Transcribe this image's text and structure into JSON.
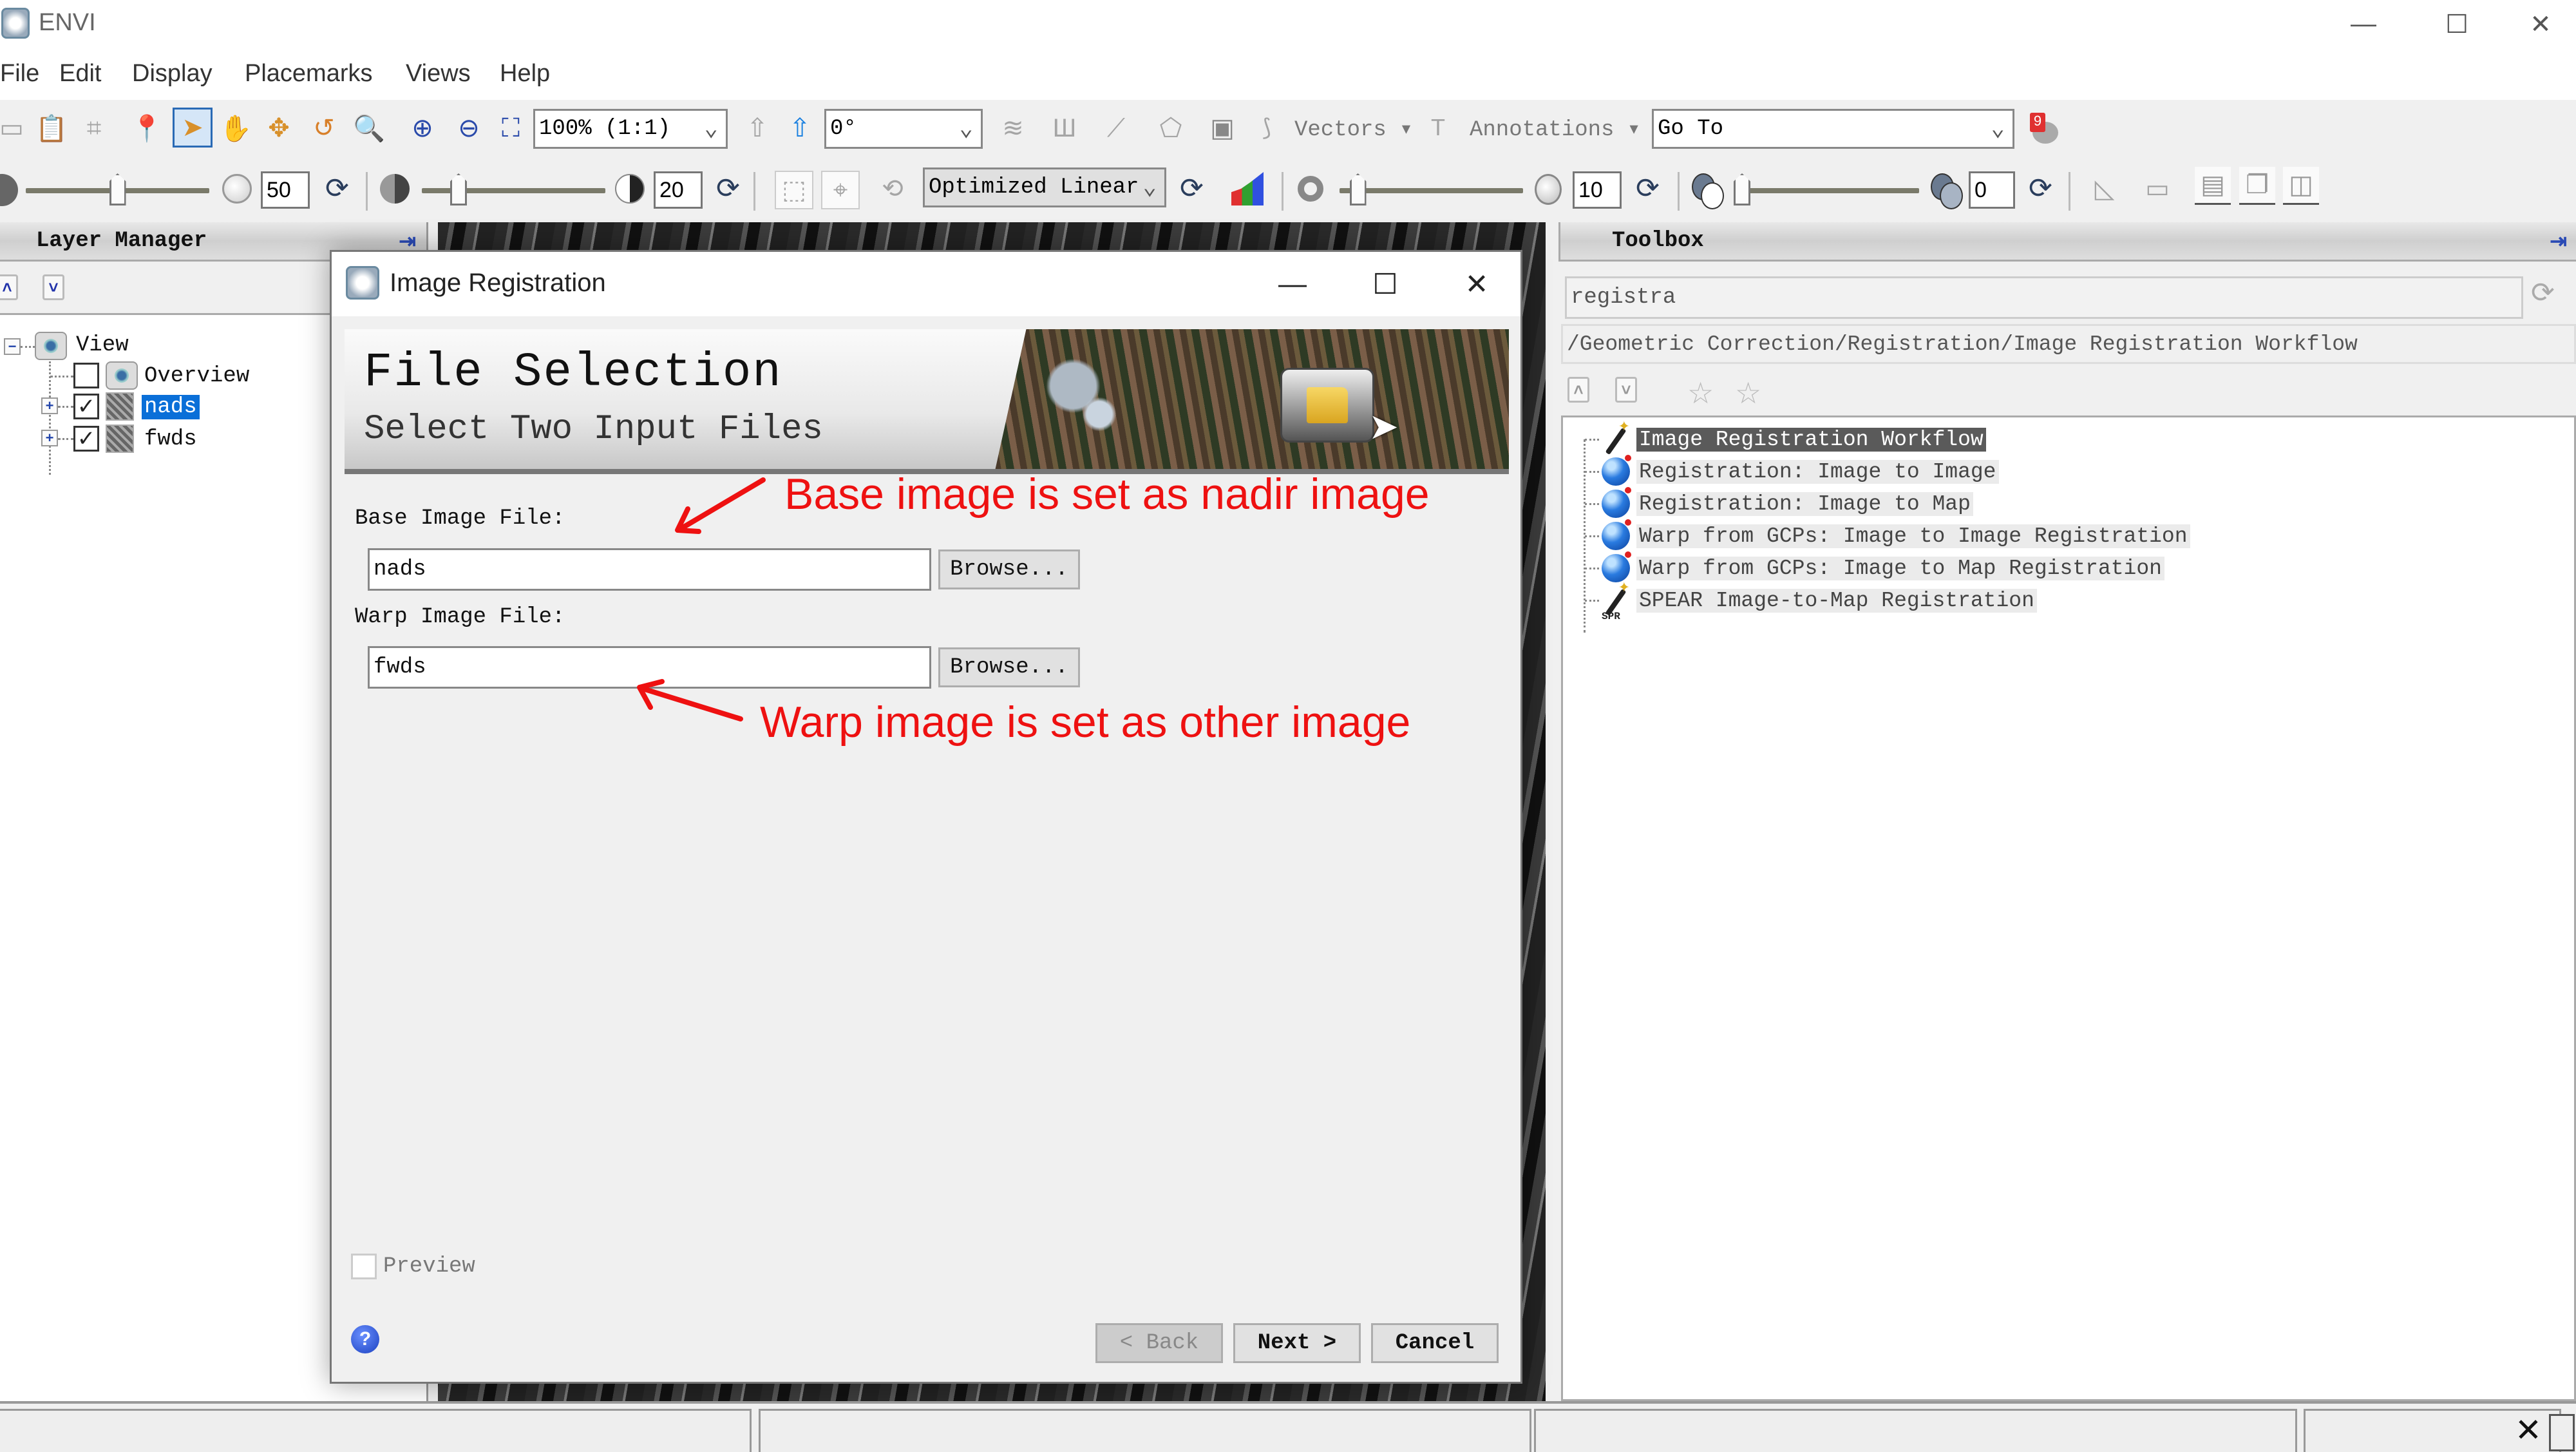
{
  "app": {
    "title": "ENVI",
    "window_controls": {
      "minimize": "—",
      "maximize": "☐",
      "close": "✕"
    }
  },
  "menu": [
    "File",
    "Edit",
    "Display",
    "Placemarks",
    "Views",
    "Help"
  ],
  "toolbar": {
    "zoom_combo": "100% (1:1)",
    "rotation_combo": "0°",
    "vectors_label": "Vectors",
    "annotations_label": "Annotations",
    "goto_combo": "Go To",
    "notification_count": "9",
    "brightness_value": "50",
    "contrast_value": "20",
    "stretch_combo": "Optimized Linear",
    "sharpen_value": "10",
    "transparency_value": "0",
    "sliders": {
      "brightness": 0.5,
      "contrast": 0.2,
      "sharpen": 0.1,
      "transparency": 0.0
    }
  },
  "layer_manager": {
    "title": "Layer Manager",
    "tree": {
      "root": "View",
      "children": [
        {
          "label": "Overview",
          "checked": false,
          "selected": false
        },
        {
          "label": "nads",
          "checked": true,
          "selected": true
        },
        {
          "label": "fwds",
          "checked": true,
          "selected": false
        }
      ]
    }
  },
  "dialog": {
    "title": "Image Registration",
    "controls": {
      "minimize": "—",
      "maximize": "☐",
      "close": "✕"
    },
    "banner_title": "File Selection",
    "banner_subtitle": "Select Two Input Files",
    "base_label": "Base Image File:",
    "base_value": "nads",
    "warp_label": "Warp Image File:",
    "warp_value": "fwds",
    "browse_label": "Browse...",
    "preview_label": "Preview",
    "preview_checked": false,
    "help_icon": "?",
    "back_label": "< Back",
    "next_label": "Next >",
    "cancel_label": "Cancel"
  },
  "annotations": {
    "base_note": "Base image is set as nadir image",
    "warp_note": "Warp image is set as other image",
    "color": "#ee1111"
  },
  "toolbox": {
    "title": "Toolbox",
    "search_value": "registra",
    "path": "/Geometric Correction/Registration/Image Registration Workflow",
    "items": [
      {
        "label": "Image Registration Workflow",
        "icon": "wand-icon",
        "selected": true
      },
      {
        "label": "Registration: Image to Image",
        "icon": "globe-icon",
        "selected": false
      },
      {
        "label": "Registration: Image to Map",
        "icon": "globe-icon",
        "selected": false
      },
      {
        "label": "Warp from GCPs: Image to Image Registration",
        "icon": "globe-icon",
        "selected": false
      },
      {
        "label": "Warp from GCPs: Image to Map Registration",
        "icon": "globe-icon",
        "selected": false
      },
      {
        "label": "SPEAR Image-to-Map Registration",
        "icon": "spear-wand-icon",
        "selected": false
      }
    ],
    "spear_badge": "SPR"
  },
  "statusbar": {
    "close_glyph": "✕"
  }
}
